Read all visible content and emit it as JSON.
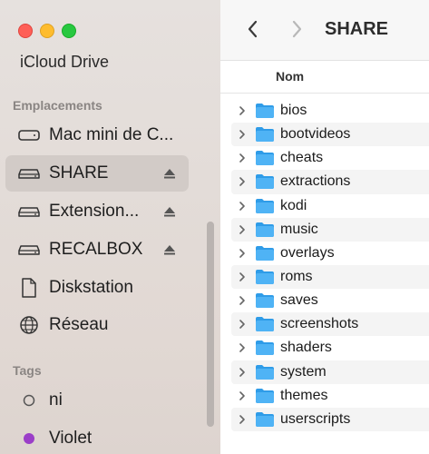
{
  "window": {
    "title": "SHARE"
  },
  "sidebar": {
    "cut_item": "iCloud Drive",
    "locations_header": "Emplacements",
    "locations": [
      {
        "label": "Mac mini de C...",
        "icon": "computer-icon",
        "selected": false,
        "eject": false
      },
      {
        "label": "SHARE",
        "icon": "drive-icon",
        "selected": true,
        "eject": true
      },
      {
        "label": "Extension...",
        "icon": "drive-icon",
        "selected": false,
        "eject": true
      },
      {
        "label": "RECALBOX",
        "icon": "drive-icon",
        "selected": false,
        "eject": true
      },
      {
        "label": "Diskstation",
        "icon": "document-icon",
        "selected": false,
        "eject": false
      },
      {
        "label": "Réseau",
        "icon": "globe-icon",
        "selected": false,
        "eject": false
      }
    ],
    "tags_header": "Tags",
    "tags": [
      {
        "label": "ni",
        "color": ""
      },
      {
        "label": "Violet",
        "color": "#9b3ec8"
      }
    ]
  },
  "list": {
    "column_name": "Nom",
    "items": [
      "bios",
      "bootvideos",
      "cheats",
      "extractions",
      "kodi",
      "music",
      "overlays",
      "roms",
      "saves",
      "screenshots",
      "shaders",
      "system",
      "themes",
      "userscripts"
    ]
  },
  "colors": {
    "folder": "#2f9ce8",
    "selection": "#d2cbc7"
  }
}
